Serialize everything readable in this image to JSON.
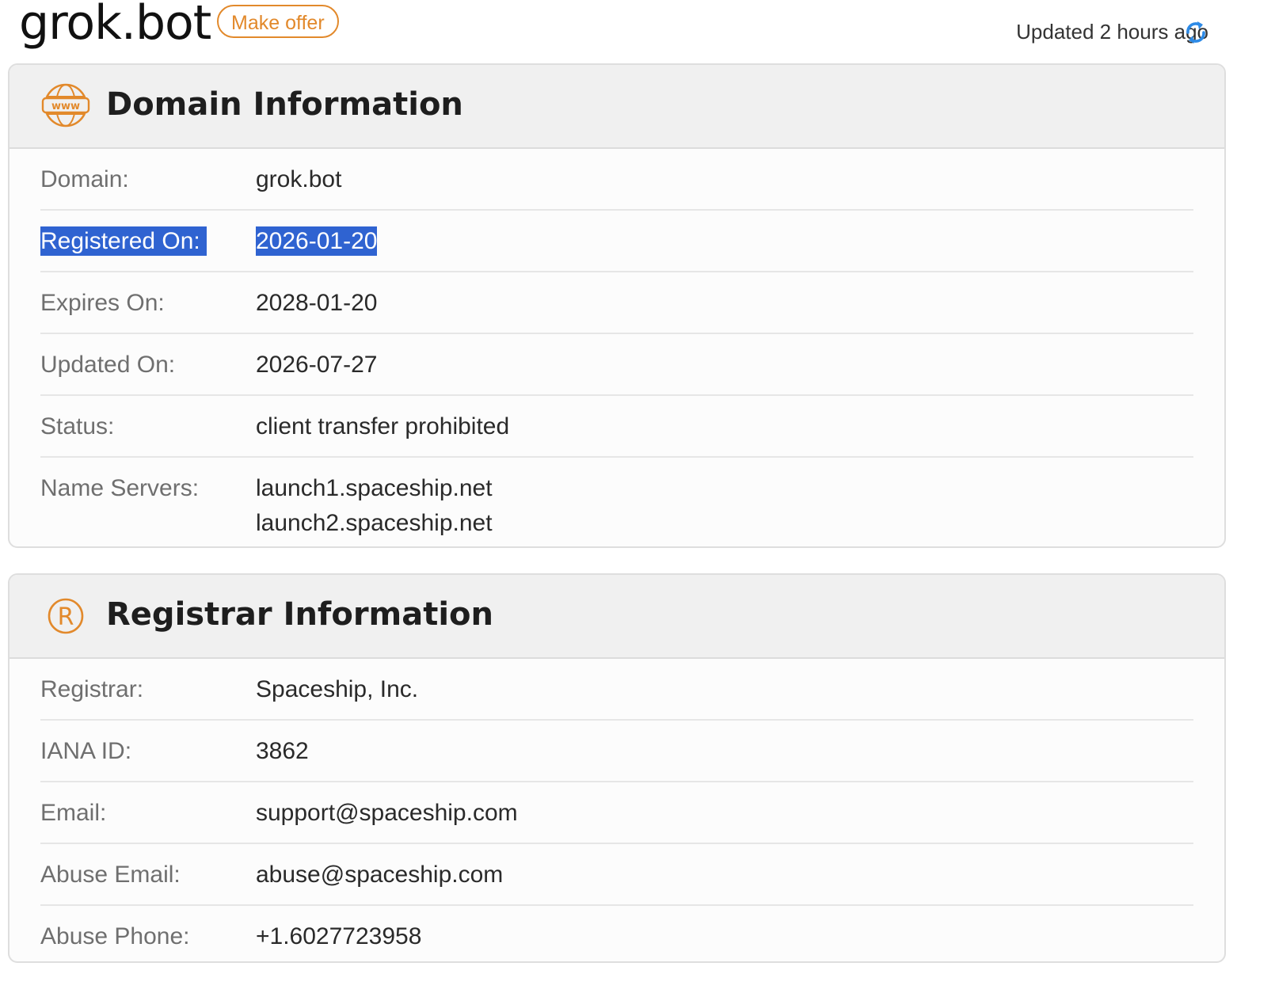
{
  "header": {
    "domain": "grok.bot",
    "offer_label": "Make offer",
    "updated_text": "Updated 2 hours ago"
  },
  "domain_info": {
    "title": "Domain Information",
    "icon": "www-globe-icon",
    "rows": [
      {
        "label": "Domain:",
        "value": "grok.bot"
      },
      {
        "label": "Registered On:",
        "value": "2026-01-20",
        "selected": true
      },
      {
        "label": "Expires On:",
        "value": "2028-01-20"
      },
      {
        "label": "Updated On:",
        "value": "2026-07-27"
      },
      {
        "label": "Status:",
        "value": "client transfer prohibited"
      },
      {
        "label": "Name Servers:",
        "values": [
          "launch1.spaceship.net",
          "launch2.spaceship.net"
        ]
      }
    ]
  },
  "registrar_info": {
    "title": "Registrar Information",
    "icon": "registered-icon",
    "rows": [
      {
        "label": "Registrar:",
        "value": "Spaceship, Inc."
      },
      {
        "label": "IANA ID:",
        "value": "3862"
      },
      {
        "label": "Email:",
        "value": "support@spaceship.com"
      },
      {
        "label": "Abuse Email:",
        "value": "abuse@spaceship.com"
      },
      {
        "label": "Abuse Phone:",
        "value": "+1.6027723958"
      }
    ]
  },
  "colors": {
    "accent_orange": "#e2892b",
    "refresh_blue": "#2d8ae6",
    "selection_blue": "#2f63d1"
  }
}
